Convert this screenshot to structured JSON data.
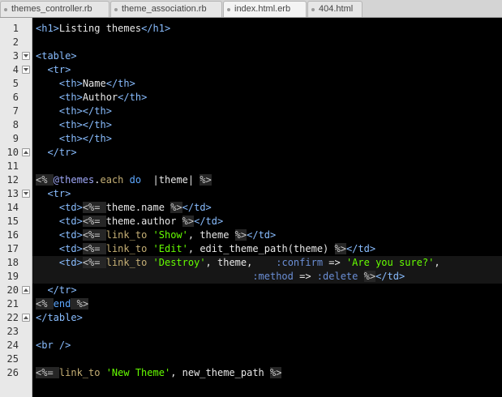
{
  "tabs": [
    {
      "label": "themes_controller.rb",
      "active": false
    },
    {
      "label": "theme_association.rb",
      "active": false
    },
    {
      "label": "index.html.erb",
      "active": true
    },
    {
      "label": "404.html",
      "active": false
    }
  ],
  "gutter": {
    "line_numbers": [
      "1",
      "2",
      "3",
      "4",
      "5",
      "6",
      "7",
      "8",
      "9",
      "10",
      "11",
      "12",
      "13",
      "14",
      "15",
      "16",
      "17",
      "18",
      "19",
      "20",
      "21",
      "22",
      "23",
      "24",
      "25",
      "26"
    ],
    "fold_markers": {
      "3": "open",
      "4": "open",
      "10": "close",
      "13": "open",
      "20": "close",
      "22": "close"
    }
  },
  "editor": {
    "highlighted_line": 18,
    "lines": [
      [
        [
          "t",
          "<h1>"
        ],
        [
          "",
          "Listing themes"
        ],
        [
          "t",
          "</h1>"
        ]
      ],
      [],
      [
        [
          "t",
          "<table>"
        ]
      ],
      [
        [
          "",
          "  "
        ],
        [
          "t",
          "<tr>"
        ]
      ],
      [
        [
          "",
          "    "
        ],
        [
          "t",
          "<th>"
        ],
        [
          "",
          "Name"
        ],
        [
          "t",
          "</th>"
        ]
      ],
      [
        [
          "",
          "    "
        ],
        [
          "t",
          "<th>"
        ],
        [
          "",
          "Author"
        ],
        [
          "t",
          "</th>"
        ]
      ],
      [
        [
          "",
          "    "
        ],
        [
          "t",
          "<th></th>"
        ]
      ],
      [
        [
          "",
          "    "
        ],
        [
          "t",
          "<th></th>"
        ]
      ],
      [
        [
          "",
          "    "
        ],
        [
          "t",
          "<th></th>"
        ]
      ],
      [
        [
          "",
          "  "
        ],
        [
          "t",
          "</tr>"
        ]
      ],
      [],
      [
        [
          "e",
          "<% "
        ],
        [
          "iv",
          "@themes"
        ],
        [
          "",
          "."
        ],
        [
          "m",
          "each"
        ],
        [
          "",
          ""
        ],
        [
          "k",
          " do"
        ],
        [
          "",
          "  |theme| "
        ],
        [
          "e",
          "%>"
        ]
      ],
      [
        [
          "",
          "  "
        ],
        [
          "t",
          "<tr>"
        ]
      ],
      [
        [
          "",
          "    "
        ],
        [
          "t",
          "<td>"
        ],
        [
          "e",
          "<%= "
        ],
        [
          "",
          "theme.name "
        ],
        [
          "e",
          "%>"
        ],
        [
          "t",
          "</td>"
        ]
      ],
      [
        [
          "",
          "    "
        ],
        [
          "t",
          "<td>"
        ],
        [
          "e",
          "<%= "
        ],
        [
          "",
          "theme.author "
        ],
        [
          "e",
          "%>"
        ],
        [
          "t",
          "</td>"
        ]
      ],
      [
        [
          "",
          "    "
        ],
        [
          "t",
          "<td>"
        ],
        [
          "e",
          "<%= "
        ],
        [
          "m",
          "link_to"
        ],
        [
          "",
          ""
        ],
        [
          "s",
          " 'Show'"
        ],
        [
          "",
          ", theme "
        ],
        [
          "e",
          "%>"
        ],
        [
          "t",
          "</td>"
        ]
      ],
      [
        [
          "",
          "    "
        ],
        [
          "t",
          "<td>"
        ],
        [
          "e",
          "<%= "
        ],
        [
          "m",
          "link_to"
        ],
        [
          "s",
          " 'Edit'"
        ],
        [
          "",
          ", edit_theme_path(theme) "
        ],
        [
          "e",
          "%>"
        ],
        [
          "t",
          "</td>"
        ]
      ],
      [
        [
          "",
          "    "
        ],
        [
          "t",
          "<td>"
        ],
        [
          "e",
          "<%= "
        ],
        [
          "m",
          "link_to"
        ],
        [
          "s",
          " 'Destroy'"
        ],
        [
          "",
          ", theme,    "
        ],
        [
          "sy",
          ":confirm"
        ],
        [
          "",
          " => "
        ],
        [
          "s",
          "'Are you sure?'"
        ],
        [
          "",
          ","
        ]
      ],
      [
        [
          "",
          "                                     "
        ],
        [
          "sy",
          ":method"
        ],
        [
          "",
          " => "
        ],
        [
          "sy",
          ":delete"
        ],
        [
          "",
          " "
        ],
        [
          "e",
          "%>"
        ],
        [
          "t",
          "</td>"
        ]
      ],
      [
        [
          "",
          "  "
        ],
        [
          "t",
          "</tr>"
        ]
      ],
      [
        [
          "e",
          "<% "
        ],
        [
          "k",
          "end"
        ],
        [
          "e",
          " %>"
        ]
      ],
      [
        [
          "t",
          "</table>"
        ]
      ],
      [],
      [
        [
          "t",
          "<br />"
        ]
      ],
      [],
      [
        [
          "e",
          "<%= "
        ],
        [
          "m",
          "link_to"
        ],
        [
          "s",
          " 'New Theme'"
        ],
        [
          "",
          ", new_theme_path "
        ],
        [
          "e",
          "%>"
        ]
      ]
    ]
  }
}
